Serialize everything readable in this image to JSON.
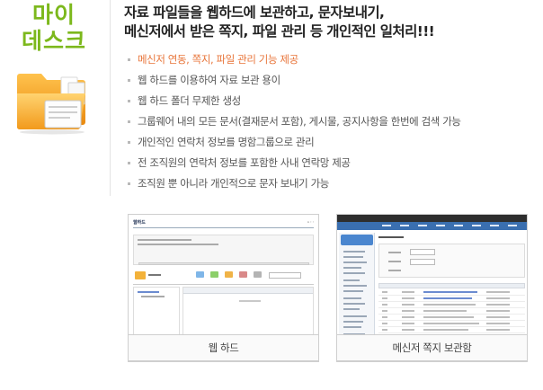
{
  "brand": {
    "title_line1": "마이",
    "title_line2": "데스크",
    "accent_color": "#7cb81c",
    "icon": "folder-icon"
  },
  "headline": {
    "line1": "자료 파일들을 웹하드에 보관하고, 문자보내기,",
    "line2": "메신저에서 받은 쪽지, 파일 관리 등 개인적인 일처리!!!"
  },
  "features": [
    {
      "label": "메신저 연동, 쪽지, 파일 관리 기능 제공",
      "highlight": true,
      "highlight_color": "#e8753a"
    },
    {
      "label": "웹 하드를 이용하여 자료 보관 용이",
      "highlight": false
    },
    {
      "label": "웹 하드 폴더 무제한 생성",
      "highlight": false
    },
    {
      "label": "그룹웨어 내의 모든 문서(결재문서 포함), 게시물, 공지사항을 한번에 검색 가능",
      "highlight": false
    },
    {
      "label": "개인적인 연락처 정보를 명함그룹으로 관리",
      "highlight": false
    },
    {
      "label": "전 조직원의 연락처 정보를 포함한 사내 연락망 제공",
      "highlight": false
    },
    {
      "label": "조직원 뿐 아니라 개인적으로 문자 보내기 가능",
      "highlight": false
    }
  ],
  "screenshots": [
    {
      "caption": "웹 하드",
      "mini_title": "웹하드"
    },
    {
      "caption": "메신저 쪽지 보관함",
      "mini_title": "메신저 쪽지"
    }
  ]
}
